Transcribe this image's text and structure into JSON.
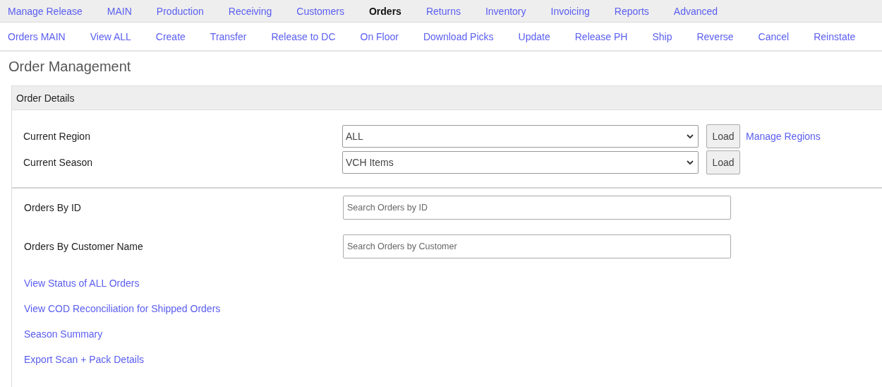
{
  "main_nav": [
    {
      "label": "Manage Release",
      "selected": false
    },
    {
      "label": "MAIN",
      "selected": false
    },
    {
      "label": "Production",
      "selected": false
    },
    {
      "label": "Receiving",
      "selected": false
    },
    {
      "label": "Customers",
      "selected": false
    },
    {
      "label": "Orders",
      "selected": true
    },
    {
      "label": "Returns",
      "selected": false
    },
    {
      "label": "Inventory",
      "selected": false
    },
    {
      "label": "Invoicing",
      "selected": false
    },
    {
      "label": "Reports",
      "selected": false
    },
    {
      "label": "Advanced",
      "selected": false
    }
  ],
  "sub_nav": [
    "Orders MAIN",
    "View ALL",
    "Create",
    "Transfer",
    "Release to DC",
    "On Floor",
    "Download Picks",
    "Update",
    "Release PH",
    "Ship",
    "Reverse",
    "Cancel",
    "Reinstate"
  ],
  "page_title": "Order Management",
  "panel": {
    "title": "Order Details",
    "selectors": [
      {
        "label": "Current Region",
        "value": "ALL",
        "button": "Load",
        "link": "Manage Regions"
      },
      {
        "label": "Current Season",
        "value": "VCH Items",
        "button": "Load"
      }
    ],
    "searches": [
      {
        "label": "Orders By ID",
        "placeholder": "Search Orders by ID"
      },
      {
        "label": "Orders By Customer Name",
        "placeholder": "Search Orders by Customer"
      }
    ],
    "links": [
      "View Status of ALL Orders",
      "View COD Reconciliation for Shipped Orders",
      "Season Summary",
      "Export Scan + Pack Details"
    ]
  }
}
